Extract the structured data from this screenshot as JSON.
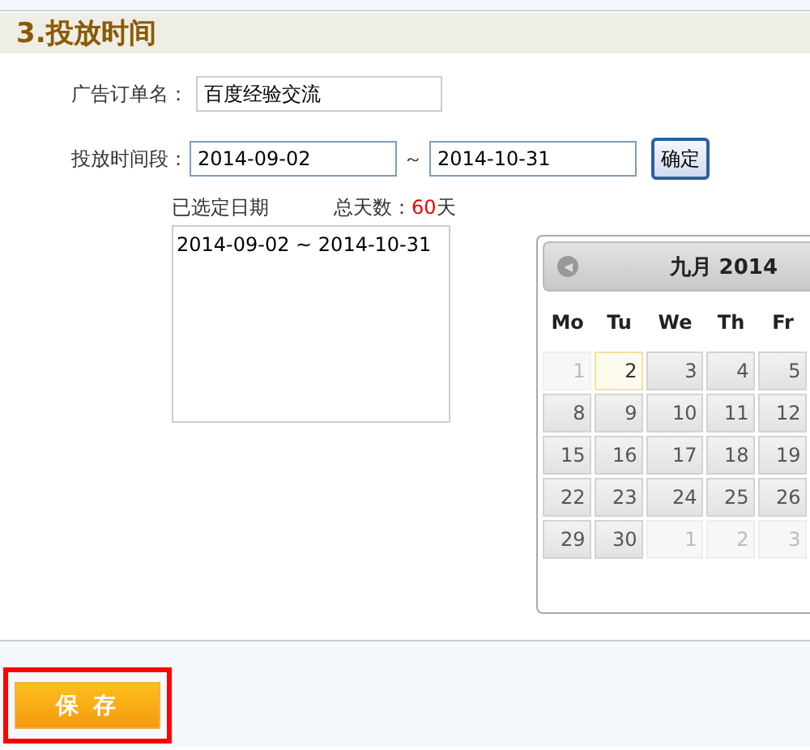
{
  "section_title": "3.投放时间",
  "order_name": {
    "label": "广告订单名：",
    "value": "百度经验交流"
  },
  "period": {
    "label": "投放时间段：",
    "start": "2014-09-02",
    "separator": "～",
    "end": "2014-10-31",
    "confirm": "确定"
  },
  "selected_dates": {
    "label": "已选定日期",
    "total_label": "总天数：",
    "total_value": "60",
    "total_unit": "天",
    "entries": "2014-09-02 ~ 2014-10-31"
  },
  "calendar": {
    "prev": "◀",
    "title": "九月 2014",
    "weekdays": [
      "Mo",
      "Tu",
      "We",
      "Th",
      "Fr"
    ],
    "weeks": [
      [
        {
          "day": "1",
          "disabled": true,
          "selected": false
        },
        {
          "day": "2",
          "disabled": false,
          "selected": true
        },
        {
          "day": "3",
          "disabled": false,
          "selected": false
        },
        {
          "day": "4",
          "disabled": false,
          "selected": false
        },
        {
          "day": "5",
          "disabled": false,
          "selected": false
        }
      ],
      [
        {
          "day": "8",
          "disabled": false,
          "selected": false
        },
        {
          "day": "9",
          "disabled": false,
          "selected": false
        },
        {
          "day": "10",
          "disabled": false,
          "selected": false
        },
        {
          "day": "11",
          "disabled": false,
          "selected": false
        },
        {
          "day": "12",
          "disabled": false,
          "selected": false
        }
      ],
      [
        {
          "day": "15",
          "disabled": false,
          "selected": false
        },
        {
          "day": "16",
          "disabled": false,
          "selected": false
        },
        {
          "day": "17",
          "disabled": false,
          "selected": false
        },
        {
          "day": "18",
          "disabled": false,
          "selected": false
        },
        {
          "day": "19",
          "disabled": false,
          "selected": false
        }
      ],
      [
        {
          "day": "22",
          "disabled": false,
          "selected": false
        },
        {
          "day": "23",
          "disabled": false,
          "selected": false
        },
        {
          "day": "24",
          "disabled": false,
          "selected": false
        },
        {
          "day": "25",
          "disabled": false,
          "selected": false
        },
        {
          "day": "26",
          "disabled": false,
          "selected": false
        }
      ],
      [
        {
          "day": "29",
          "disabled": false,
          "selected": false
        },
        {
          "day": "30",
          "disabled": false,
          "selected": false
        },
        {
          "day": "1",
          "disabled": true,
          "selected": false
        },
        {
          "day": "2",
          "disabled": true,
          "selected": false
        },
        {
          "day": "3",
          "disabled": true,
          "selected": false
        }
      ]
    ]
  },
  "save_button": {
    "label": "保 存",
    "highlighted": true
  }
}
